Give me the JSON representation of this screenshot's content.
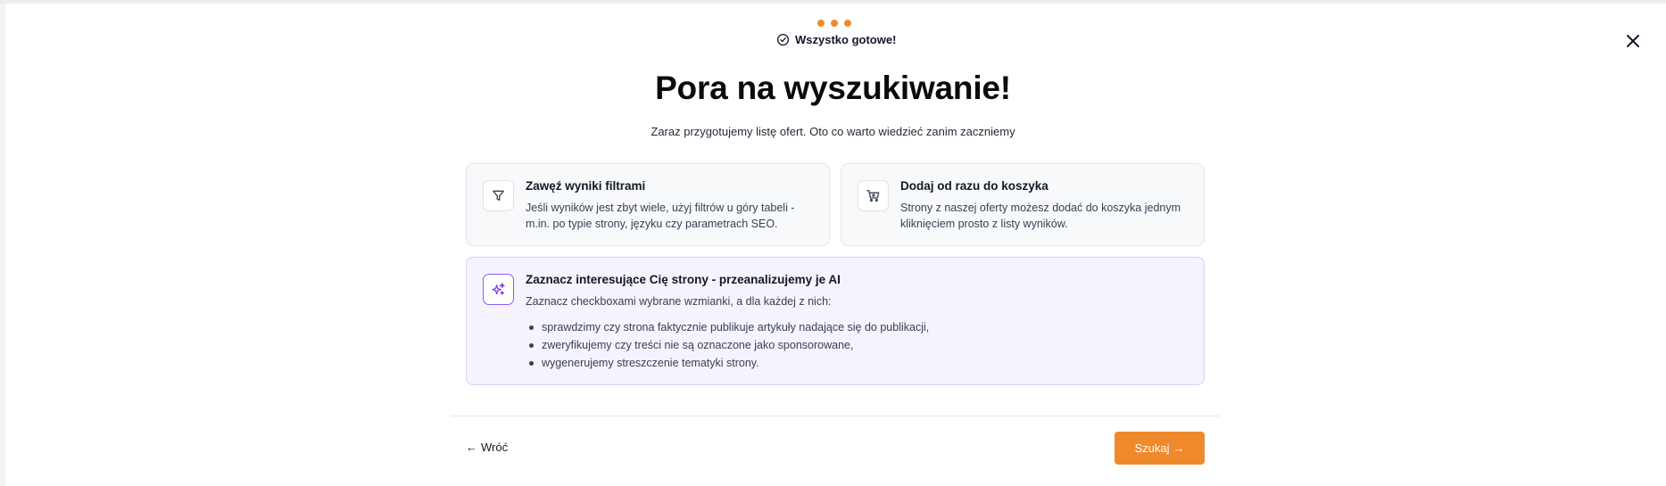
{
  "header": {
    "status_text": "Wszystko gotowe!",
    "status_icon": "check-circle-icon",
    "close_icon": "close-icon",
    "progress_dots": 3,
    "accent_color": "#ef8a2c"
  },
  "main": {
    "title": "Pora na wyszukiwanie!",
    "subtitle": "Zaraz przygotujemy listę ofert. Oto co warto wiedzieć zanim zaczniemy"
  },
  "cards": {
    "filters": {
      "icon": "filter-icon",
      "title": "Zawęź wyniki filtrami",
      "description": "Jeśli wyników jest zbyt wiele, użyj filtrów u góry tabeli - m.in. po typie strony, języku czy parametrach SEO."
    },
    "cart": {
      "icon": "shopping-cart-icon",
      "title": "Dodaj od razu do koszyka",
      "description": "Strony z naszej oferty możesz dodać do koszyka jednym kliknięciem prosto z listy wyników."
    },
    "ai": {
      "icon": "sparkles-icon",
      "title": "Zaznacz interesujące Cię strony - przeanalizujemy je AI",
      "description": "Zaznacz checkboxami wybrane wzmianki, a dla każdej z nich:",
      "bullets": [
        "sprawdzimy czy strona faktycznie publikuje artykuły nadające się do publikacji,",
        "zweryfikujemy czy treści nie są oznaczone jako sponsorowane,",
        "wygenerujemy streszczenie tematyki strony."
      ]
    }
  },
  "footer": {
    "back_arrow": "←",
    "back_label": "Wróć",
    "search_label": "Szukaj",
    "search_arrow": "→"
  }
}
